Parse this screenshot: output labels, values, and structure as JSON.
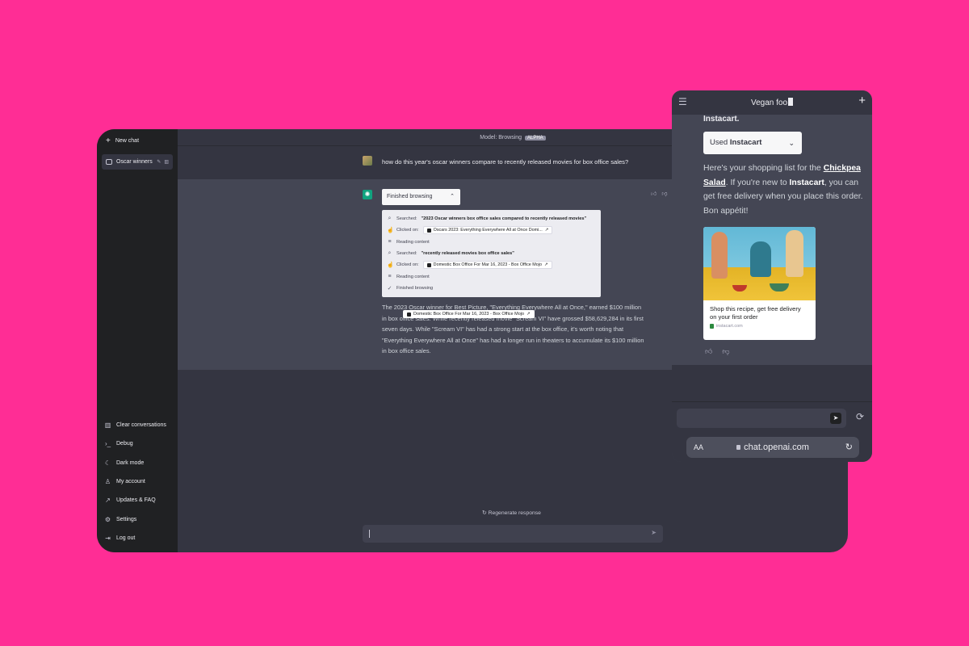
{
  "sidebar": {
    "new_chat": "New chat",
    "conversation": "Oscar winners",
    "items": [
      {
        "label": "Clear conversations",
        "icon": "trash-icon"
      },
      {
        "label": "Debug",
        "icon": "terminal-icon"
      },
      {
        "label": "Dark mode",
        "icon": "moon-icon"
      },
      {
        "label": "My account",
        "icon": "user-icon"
      },
      {
        "label": "Updates & FAQ",
        "icon": "external-link-icon"
      },
      {
        "label": "Settings",
        "icon": "gear-icon"
      },
      {
        "label": "Log out",
        "icon": "logout-icon"
      }
    ]
  },
  "header": {
    "model_label": "Model: Browsing",
    "badge": "ALPHA"
  },
  "conversation": {
    "user_message": "how do this year's oscar winners compare to recently released movies for box office sales?",
    "finished_button": "Finished browsing",
    "browse_steps": [
      {
        "icon": "search-icon",
        "prefix": "Searched:",
        "bold": "\"2023 Oscar winners box office sales compared to recently released movies\""
      },
      {
        "icon": "click-icon",
        "prefix": "Clicked on:",
        "chip": "Oscars 2023: Everything Everywhere All at Once Domi..."
      },
      {
        "icon": "list-icon",
        "prefix": "Reading content"
      },
      {
        "icon": "search-icon",
        "prefix": "Searched:",
        "bold": "\"recently released movies box office sales\""
      },
      {
        "icon": "click-icon",
        "prefix": "Clicked on:",
        "chip": "Domestic Box Office For Mar 16, 2023 - Box Office Mojo"
      },
      {
        "icon": "list-icon",
        "prefix": "Reading content"
      },
      {
        "icon": "check-circle-icon",
        "prefix": "Finished browsing"
      }
    ],
    "answer": "The 2023 Oscar winner for Best Picture, \"Everything Everywhere All at Once,\" earned $100 million in box office sales. While recently released movie \"Scream VI\" have grossed $58,629,284 in its first seven days. While \"Scream VI\" has had a strong start at the box office, it's worth noting that \"Everything Everywhere All at Once\" has had a longer run in theaters to accumulate its $100 million in box office sales.",
    "tooltip": "Domestic Box Office For Mar 16, 2023 - Box Office Mojo",
    "regenerate": "Regenerate response"
  },
  "mobile": {
    "title": "Vegan foo",
    "prev_text": "Instacart.",
    "used_prefix": "Used ",
    "used_plugin": "Instacart",
    "msg_1": "Here's your shopping list for the ",
    "msg_link": "Chickpea Salad",
    "msg_2": ". If you're new to ",
    "msg_bold": "Instacart",
    "msg_3": ", you can get free delivery when you place this order. Bon appétit!",
    "card_caption": "Shop this recipe, get free delivery on your first order",
    "card_source": "instacart.com",
    "aa": "AA",
    "url": "chat.openai.com"
  }
}
